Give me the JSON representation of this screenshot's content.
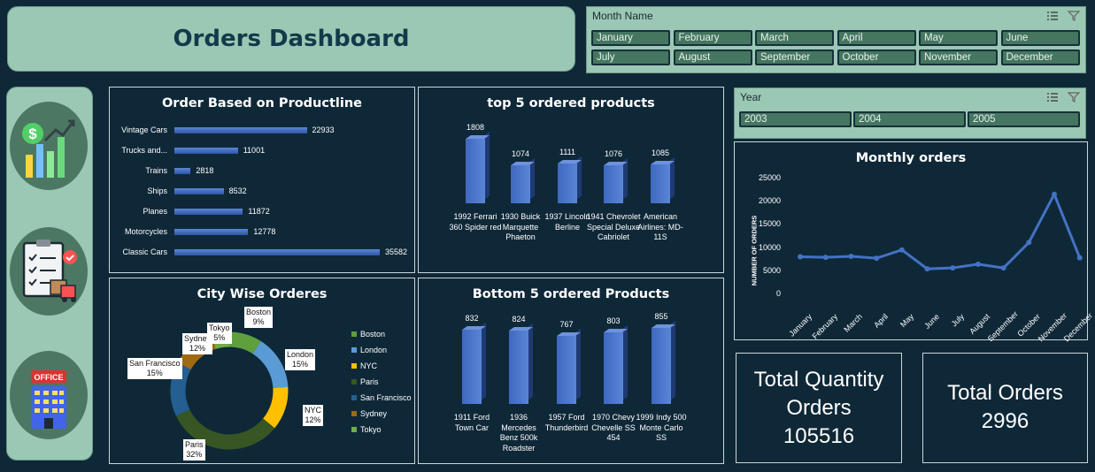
{
  "dashboard": {
    "title": "Orders Dashboard"
  },
  "month_slicer": {
    "label": "Month Name",
    "months": [
      "January",
      "February",
      "March",
      "April",
      "May",
      "June",
      "July",
      "August",
      "September",
      "October",
      "November",
      "December"
    ]
  },
  "year_slicer": {
    "label": "Year",
    "years": [
      "2003",
      "2004",
      "2005"
    ]
  },
  "sidebar": {
    "icons": [
      "finance-chart-icon",
      "clipboard-delivery-icon",
      "office-building-icon"
    ],
    "office_sign": "OFFICE"
  },
  "colors": {
    "bar": "#4472c4",
    "panel_bg": "#0f2838",
    "accent": "#9bc8b4",
    "button": "#45765f"
  },
  "productline_chart": {
    "title": "Order Based on Productline"
  },
  "top5_chart": {
    "title": "top 5 ordered products"
  },
  "city_chart": {
    "title": "City Wise Orderes"
  },
  "bottom5_chart": {
    "title": "Bottom 5 ordered Products"
  },
  "monthly_chart": {
    "title": "Monthly orders",
    "ylabel": "NUMBER OF ORDERS"
  },
  "kpi": {
    "quantity": {
      "line1": "Total Quantity",
      "line2": "Orders",
      "value": "105516"
    },
    "orders": {
      "line1": "Total Orders",
      "value": "2996"
    }
  },
  "chart_data": [
    {
      "type": "bar",
      "orientation": "horizontal",
      "title": "Order Based on Productline",
      "categories": [
        "Vintage Cars",
        "Trucks and...",
        "Trains",
        "Ships",
        "Planes",
        "Motorcycles",
        "Classic Cars"
      ],
      "values": [
        22933,
        11001,
        2818,
        8532,
        11872,
        12778,
        35582
      ]
    },
    {
      "type": "bar",
      "title": "top 5 ordered products",
      "categories": [
        "1992 Ferrari 360 Spider red",
        "1930 Buick Marquette Phaeton",
        "1937 Lincoln Berline",
        "1941 Chevrolet Special Deluxe Cabriolet",
        "American Airlines: MD-11S"
      ],
      "values": [
        1808,
        1074,
        1111,
        1076,
        1085
      ]
    },
    {
      "type": "pie",
      "title": "City Wise Orderes",
      "categories": [
        "Boston",
        "London",
        "NYC",
        "Paris",
        "San Francisco",
        "Sydney",
        "Tokyo"
      ],
      "values": [
        9,
        15,
        12,
        32,
        15,
        12,
        5
      ],
      "labels": [
        "9%",
        "15%",
        "12%",
        "32%",
        "15%",
        "12%",
        "5%"
      ],
      "colors": [
        "#5f9f3e",
        "#5b9bd5",
        "#ffc000",
        "#375623",
        "#255e91",
        "#9e6a13",
        "#70ad47"
      ],
      "legend": "right"
    },
    {
      "type": "bar",
      "title": "Bottom 5 ordered Products",
      "categories": [
        "1911 Ford Town Car",
        "1936 Mercedes Benz 500k Roadster",
        "1957 Ford Thunderbird",
        "1970 Chevy Chevelle SS 454",
        "1999 Indy 500 Monte Carlo SS"
      ],
      "values": [
        832,
        824,
        767,
        803,
        855
      ]
    },
    {
      "type": "line",
      "title": "Monthly orders",
      "ylabel": "NUMBER OF ORDERS",
      "x": [
        "January",
        "February",
        "March",
        "April",
        "May",
        "June",
        "July",
        "August",
        "September",
        "October",
        "November",
        "December"
      ],
      "values": [
        8100,
        8000,
        8200,
        7800,
        9600,
        5500,
        5700,
        6500,
        5700,
        11200,
        21600,
        7900
      ],
      "ylim": [
        0,
        25000
      ],
      "yticks": [
        0,
        5000,
        10000,
        15000,
        20000,
        25000
      ],
      "grid": false
    }
  ]
}
